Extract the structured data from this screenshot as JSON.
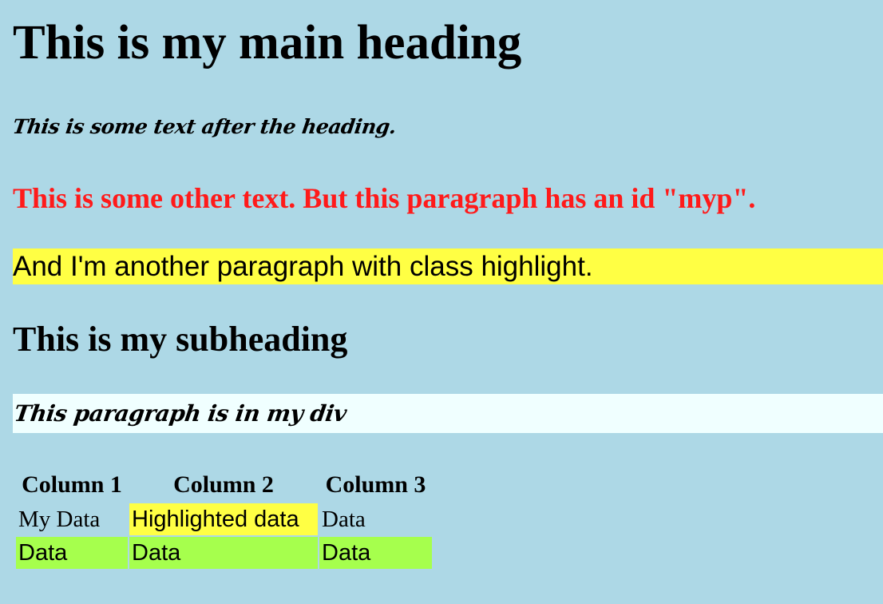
{
  "main_heading": "This is my main heading",
  "after_heading_text": "This is some text after the heading.",
  "myp_text": "This is some other text. But this paragraph has an id \"myp\".",
  "highlight_text": "And I'm another paragraph with class highlight.",
  "subheading": "This is my subheading",
  "div_text": "This paragraph is in my div",
  "table": {
    "headers": [
      "Column 1",
      "Column 2",
      "Column 3"
    ],
    "rows": [
      [
        "My Data",
        "Highlighted data",
        "Data"
      ],
      [
        "Data",
        "Data",
        "Data"
      ]
    ]
  },
  "colors": {
    "page_background": "#add8e6",
    "myp_text": "#ff1a1a",
    "highlight": "#ffff44",
    "div_background": "#f0ffff",
    "green_row": "#a6ff4d"
  }
}
